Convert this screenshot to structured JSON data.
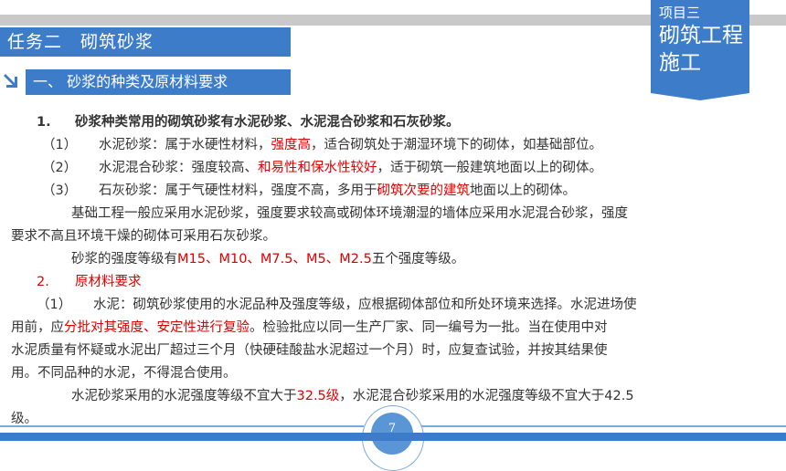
{
  "header": {
    "task_title": "任务二　砌筑砂浆",
    "project_label": "项目三",
    "project_title_1": "砌筑工程",
    "project_title_2": "施工",
    "section_title": "一、  砂浆的种类及原材料要求"
  },
  "content": {
    "h1_num": "1.",
    "h1_text": "砂浆种类常用的砌筑砂浆有水泥砂浆、水泥混合砂浆和石灰砂浆。",
    "item1_num": "（1）",
    "item1_a": "水泥砂浆：属于水硬性材料，",
    "item1_red": "强度高",
    "item1_b": "，适合砌筑处于潮湿环境下的砌体，如基础部位。",
    "item2_num": "（2）",
    "item2_a": "水泥混合砂浆：强度较高、",
    "item2_red": "和易性和保水性较好",
    "item2_b": "，适于砌筑一般建筑地面以上的砌体。",
    "item3_num": "（3）",
    "item3_a": "石灰砂浆：属于气硬性材料，强度不高，多用于",
    "item3_red": "砌筑次要的建筑",
    "item3_b": "地面以上的砌体。",
    "para1_l1": "基础工程一般应采用水泥砂浆，强度要求较高或砌体环境潮湿的墙体应采用水泥混合砂浆，强度",
    "para1_l2": "要求不高且环境干燥的砌体可采用石灰砂浆。",
    "para2_a": "砂浆的强度等级有",
    "para2_red": "M15、M10、M7.5、M5、M2.5",
    "para2_b": "五个强度等级。",
    "h2_num": "2.",
    "h2_text": "原材料要求",
    "cement_num": "（1）",
    "cement_l1": "水泥：砌筑砂浆使用的水泥品种及强度等级，应根据砌体部位和所处环境来选择。水泥进场使",
    "cement_l2_a": "用前，应",
    "cement_l2_red": "分批对其强度、安定性进行复验",
    "cement_l2_b": "。检验批应以同一生产厂家、同一编号为一批。当在使用中对",
    "cement_l3": "水泥质量有怀疑或水泥出厂超过三个月（快硬硅酸盐水泥超过一个月）时，应复查试验，并按其结果使",
    "cement_l4": "用。不同品种的水泥，不得混合使用。",
    "last_a": "水泥砂浆采用的水泥强度等级不宜大于",
    "last_red": "32.5级",
    "last_b": "，水泥混合砂浆采用的水泥强度等级不宜大于42.5",
    "last_l2": "级。"
  },
  "footer": {
    "page_number": "7"
  },
  "colors": {
    "accent": "#3d7cc9",
    "highlight": "#e00000",
    "bar_gray": "#c9c9c9"
  }
}
